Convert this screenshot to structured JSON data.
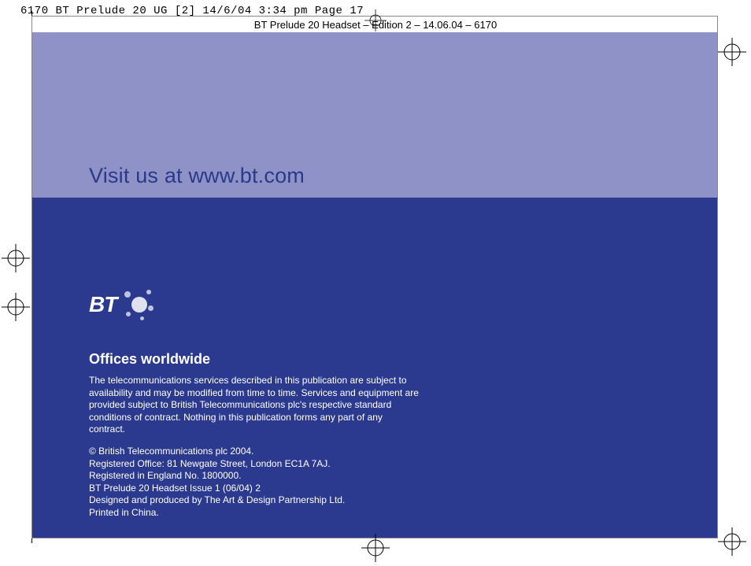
{
  "print_header": "6170 BT Prelude 20 UG [2]  14/6/04  3:34 pm  Page 17",
  "doc_header": "BT Prelude 20 Headset – Edition 2 – 14.06.04 – 6170",
  "visit": "Visit us at www.bt.com",
  "logo_text": "BT",
  "offices_heading": "Offices worldwide",
  "paragraph1": "The telecommunications services described in this publication are subject to availability and may be modified from time to time. Services and equipment are provided subject to British Telecommunications plc's respective standard conditions of contract. Nothing in this publication forms any part of any contract.",
  "legal": {
    "l1": "© British Telecommunications plc 2004.",
    "l2": "Registered Office: 81 Newgate Street, London EC1A 7AJ.",
    "l3": "Registered in England No. 1800000.",
    "l4": "BT Prelude 20 Headset  Issue 1  (06/04)  2",
    "l5": "Designed and produced by The Art & Design Partnership Ltd.",
    "l6": "Printed in China."
  }
}
